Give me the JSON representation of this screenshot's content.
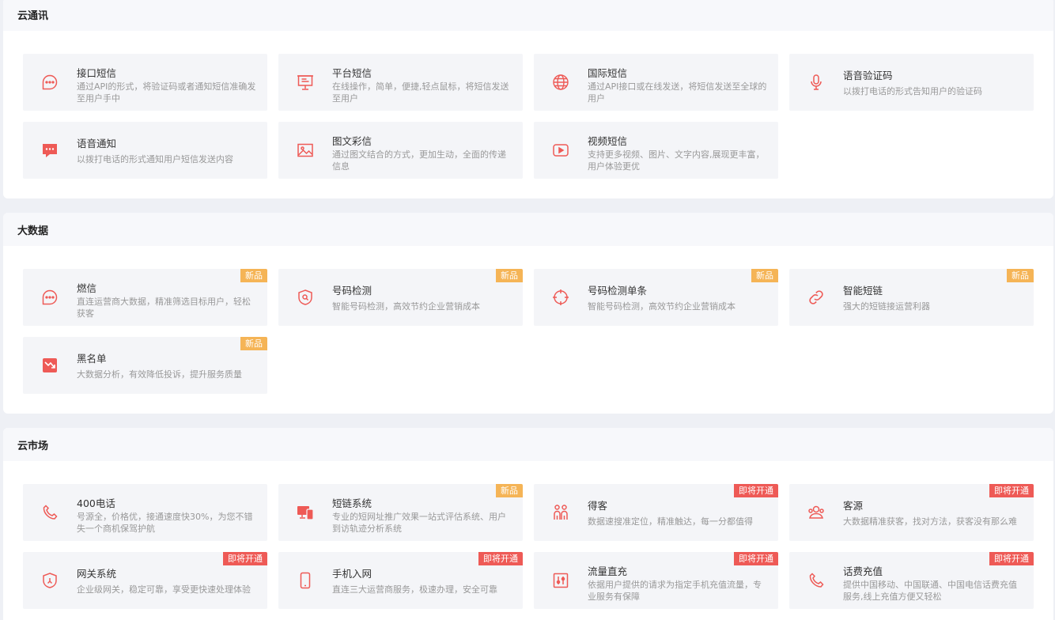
{
  "sections": [
    {
      "title": "云通讯",
      "cards": [
        {
          "title": "接口短信",
          "desc": "通过API的形式，将验证码或者通知短信准确发至用户手中",
          "icon": "chat-bubble-icon",
          "badge": ""
        },
        {
          "title": "平台短信",
          "desc": "在线操作，简单，便捷,轻点鼠标，将短信发送至用户",
          "icon": "presentation-screen-icon",
          "badge": ""
        },
        {
          "title": "国际短信",
          "desc": "通过API接口或在线发送，将短信发送至全球的用户",
          "icon": "globe-icon",
          "badge": ""
        },
        {
          "title": "语音验证码",
          "desc": "以拨打电话的形式告知用户的验证码",
          "icon": "microphone-icon",
          "badge": ""
        },
        {
          "title": "语音通知",
          "desc": "以拨打电话的形式通知用户短信发送内容",
          "icon": "message-filled-icon",
          "badge": ""
        },
        {
          "title": "图文彩信",
          "desc": "通过图文结合的方式，更加生动，全面的传递信息",
          "icon": "image-icon",
          "badge": ""
        },
        {
          "title": "视频短信",
          "desc": "支持更多视频、图片、文字内容,展现更丰富，用户体验更优",
          "icon": "video-play-icon",
          "badge": ""
        }
      ]
    },
    {
      "title": "大数据",
      "cards": [
        {
          "title": "燃信",
          "desc": "直连运营商大数据，精准筛选目标用户，轻松获客",
          "icon": "chat-bubble-icon",
          "badge": "新品"
        },
        {
          "title": "号码检测",
          "desc": "智能号码检测，高效节约企业营销成本",
          "icon": "shield-search-icon",
          "badge": "新品"
        },
        {
          "title": "号码检测单条",
          "desc": "智能号码检测，高效节约企业营销成本",
          "icon": "crosshair-icon",
          "badge": "新品"
        },
        {
          "title": "智能短链",
          "desc": "强大的短链接运营利器",
          "icon": "link-icon",
          "badge": "新品"
        },
        {
          "title": "黑名单",
          "desc": "大数据分析，有效降低投诉，提升服务质量",
          "icon": "trend-down-filled-icon",
          "badge": "新品"
        }
      ]
    },
    {
      "title": "云市场",
      "cards": [
        {
          "title": "400电话",
          "desc": "号源全，价格优，接通速度快30%，为您不错失一个商机保驾护航",
          "icon": "phone-icon",
          "badge": ""
        },
        {
          "title": "短链系统",
          "desc": "专业的短网址推广效果一站式评估系统、用户到访轨迹分析系统",
          "icon": "devices-icon",
          "badge": "新品"
        },
        {
          "title": "得客",
          "desc": "数据速搜准定位，精准触达，每一分都值得",
          "icon": "people-icon",
          "badge": "即将开通"
        },
        {
          "title": "客源",
          "desc": "大数据精准获客，找对方法，获客没有那么难",
          "icon": "customer-group-icon",
          "badge": "即将开通"
        },
        {
          "title": "网关系统",
          "desc": "企业级网关，稳定可靠，享受更快速处理体验",
          "icon": "shield-gateway-icon",
          "badge": "即将开通"
        },
        {
          "title": "手机入网",
          "desc": "直连三大运营商服务，极速办理，安全可靠",
          "icon": "mobile-phone-icon",
          "badge": "即将开通"
        },
        {
          "title": "流量直充",
          "desc": "依据用户提供的请求为指定手机充值流量，专业服务有保障",
          "icon": "flow-meter-icon",
          "badge": "即将开通"
        },
        {
          "title": "话费充值",
          "desc": "提供中国移动、中国联通、中国电信话费充值服务,线上充值方便又轻松",
          "icon": "phone-icon",
          "badge": "即将开通"
        }
      ]
    }
  ],
  "colors": {
    "accent": "#ee5a56",
    "badge_new": "#f5b456",
    "badge_soon": "#ee5a56"
  }
}
